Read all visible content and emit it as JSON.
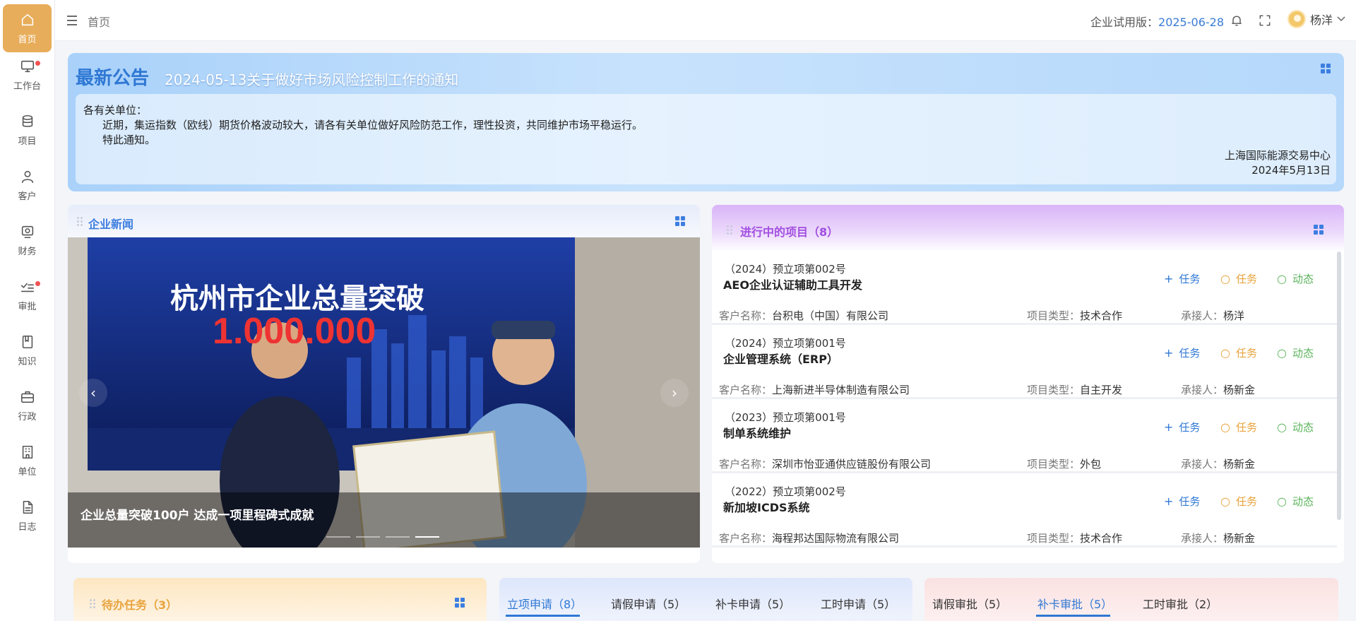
{
  "sidebar": {
    "items": [
      {
        "label": "首页",
        "icon": "home-icon",
        "active": true
      },
      {
        "label": "工作台",
        "icon": "monitor-icon",
        "badge": true
      },
      {
        "label": "项目",
        "icon": "database-icon"
      },
      {
        "label": "客户",
        "icon": "user-icon"
      },
      {
        "label": "财务",
        "icon": "finance-icon"
      },
      {
        "label": "审批",
        "icon": "approve-icon",
        "badge": true
      },
      {
        "label": "知识",
        "icon": "book-icon"
      },
      {
        "label": "行政",
        "icon": "briefcase-icon"
      },
      {
        "label": "单位",
        "icon": "building-icon"
      },
      {
        "label": "日志",
        "icon": "document-icon"
      }
    ]
  },
  "header": {
    "breadcrumb": "首页",
    "trial_label": "企业试用版：",
    "trial_date": "2025-06-28",
    "user_name": "杨洋"
  },
  "announcement": {
    "title": "最新公告",
    "subtitle": "2024-05-13关于做好市场风险控制工作的通知",
    "greeting": "各有关单位：",
    "body": "近期，集运指数（欧线）期货价格波动较大，请各有关单位做好风险防范工作，理性投资，共同维护市场平稳运行。",
    "closing": "特此通知。",
    "signature": "上海国际能源交易中心",
    "date": "2024年5月13日"
  },
  "news": {
    "title": "企业新闻",
    "caption": "企业总量突破100户 达成一项里程碑式成就",
    "image_headline": "杭州市企业总量突破",
    "image_number": "1,000,000",
    "prev": "‹",
    "next": "›",
    "slide_count": 4,
    "active_slide": 4
  },
  "projects": {
    "title": "进行中的项目（8）",
    "labels": {
      "customer": "客户名称：",
      "type": "项目类型：",
      "owner": "承接人："
    },
    "actions": {
      "add_task": "任务",
      "search_task": "任务",
      "activity": "动态"
    },
    "items": [
      {
        "no": "（2024）预立项第002号",
        "name": "AEO企业认证辅助工具开发",
        "customer": "台积电（中国）有限公司",
        "type": "技术合作",
        "owner": "杨洋"
      },
      {
        "no": "（2024）预立项第001号",
        "name": "企业管理系统（ERP）",
        "customer": "上海新进半导体制造有限公司",
        "type": "自主开发",
        "owner": "杨新金"
      },
      {
        "no": "（2023）预立项第001号",
        "name": "制单系统维护",
        "customer": "深圳市怡亚通供应链股份有限公司",
        "type": "外包",
        "owner": "杨新金"
      },
      {
        "no": "（2022）预立项第002号",
        "name": "新加坡ICDS系统",
        "customer": "海程邦达国际物流有限公司",
        "type": "技术合作",
        "owner": "杨新金"
      }
    ]
  },
  "todo": {
    "title": "待办任务（3）"
  },
  "applications": {
    "tabs": [
      "立项申请（8）",
      "请假申请（5）",
      "补卡申请（5）",
      "工时申请（5）"
    ],
    "active": 0
  },
  "approvals": {
    "tabs": [
      "请假审批（5）",
      "补卡审批（5）",
      "工时审批（2）"
    ],
    "active": 1
  },
  "colors": {
    "accent": "#e8ad5a",
    "link_blue": "#2f78d4",
    "task_orange": "#e8a33d",
    "activity_green": "#5bb35b",
    "project_title_purple": "#a24fe0"
  }
}
